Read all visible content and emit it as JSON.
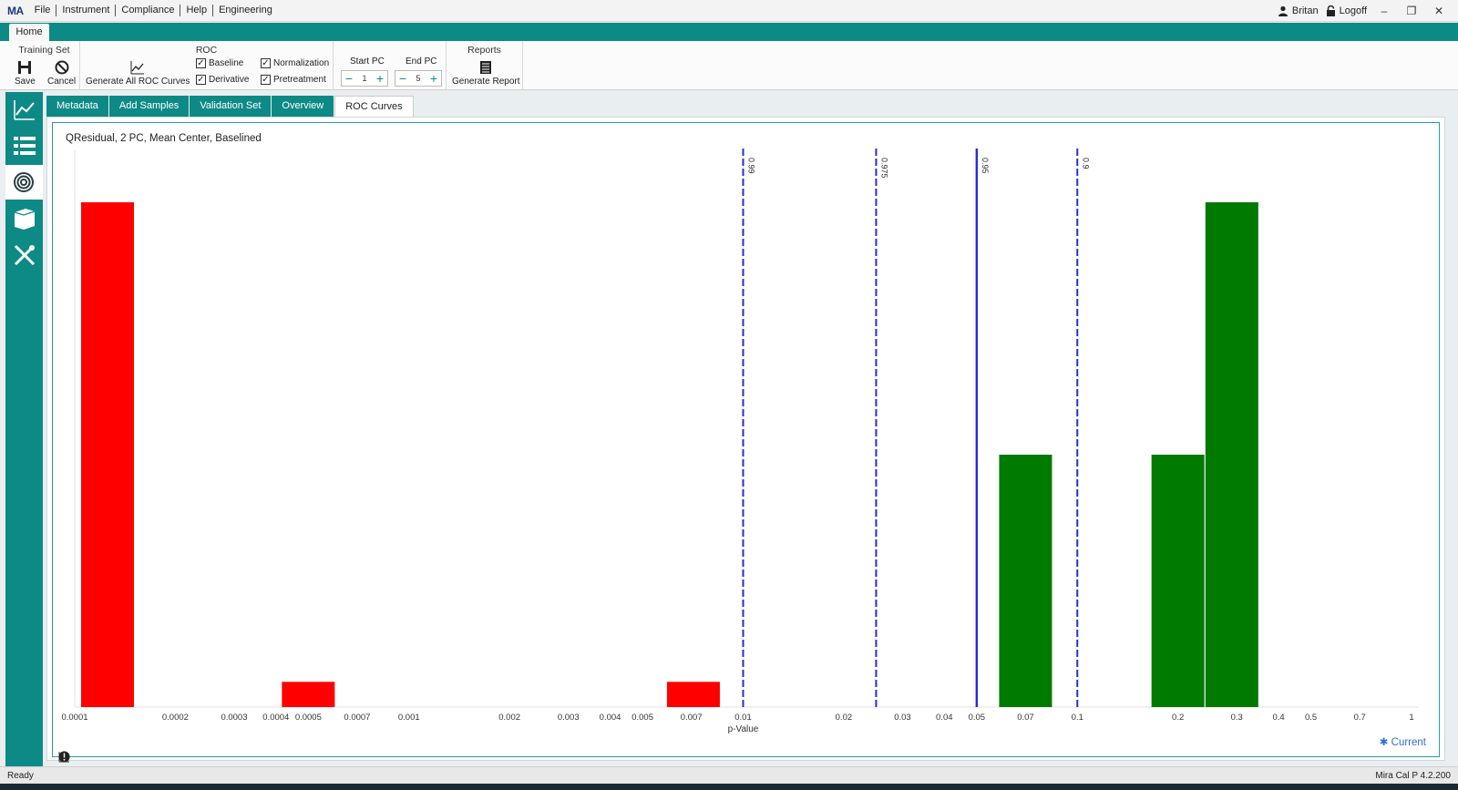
{
  "app": {
    "logo": "MA",
    "menu": [
      "File",
      "Instrument",
      "Compliance",
      "Help",
      "Engineering"
    ],
    "user": "Britan",
    "logoff": "Logoff"
  },
  "ribbon": {
    "tab": "Home",
    "training_set": {
      "title": "Training Set",
      "save": "Save",
      "cancel": "Cancel"
    },
    "roc": {
      "title": "ROC",
      "generate_all": "Generate All ROC Curves",
      "baseline": "Baseline",
      "derivative": "Derivative",
      "normalization": "Normalization",
      "pretreatment": "Pretreatment",
      "start_pc_label": "Start PC",
      "start_pc_value": "1",
      "end_pc_label": "End PC",
      "end_pc_value": "5"
    },
    "reports": {
      "title": "Reports",
      "generate_report": "Generate Report"
    }
  },
  "tabs": [
    "Metadata",
    "Add Samples",
    "Validation Set",
    "Overview",
    "ROC Curves"
  ],
  "active_tab": "ROC Curves",
  "chart_data": {
    "type": "bar",
    "title": "QResidual, 2 PC, Mean Center, Baselined",
    "xlabel": "p-Value",
    "xscale": "log",
    "xlim": [
      0.0001,
      1
    ],
    "x_ticks": [
      "0.0001",
      "0.0002",
      "0.0003",
      "0.0004",
      "0.0005",
      "0.0007",
      "0.001",
      "0.002",
      "0.003",
      "0.004",
      "0.005",
      "0.007",
      "0.01",
      "0.02",
      "0.03",
      "0.04",
      "0.05",
      "0.07",
      "0.1",
      "0.2",
      "0.3",
      "0.4",
      "0.5",
      "0.7",
      "1"
    ],
    "ylim": [
      0,
      1
    ],
    "grid": false,
    "bars": [
      {
        "x": 0.0001,
        "value": 1.0,
        "color": "#ff0000"
      },
      {
        "x": 0.0005,
        "value": 0.05,
        "color": "#ff0000"
      },
      {
        "x": 0.0071,
        "value": 0.05,
        "color": "#ff0000"
      },
      {
        "x": 0.07,
        "value": 0.5,
        "color": "#007a00"
      },
      {
        "x": 0.2,
        "value": 0.5,
        "color": "#007a00"
      },
      {
        "x": 0.29,
        "value": 1.0,
        "color": "#007a00"
      }
    ],
    "threshold_lines": [
      {
        "x": 0.01,
        "label": "0.99",
        "style": "dashed"
      },
      {
        "x": 0.025,
        "label": "0.975",
        "style": "dashed"
      },
      {
        "x": 0.05,
        "label": "0.95",
        "style": "solid"
      },
      {
        "x": 0.1,
        "label": "0.9",
        "style": "dashed"
      }
    ],
    "legend": "Current"
  },
  "status": {
    "left": "Ready",
    "version": "Mira Cal P 4.2.200"
  },
  "colors": {
    "teal": "#0e8a86",
    "red": "#ff0000",
    "green": "#007a00",
    "threshold": "#2b2bd6"
  }
}
